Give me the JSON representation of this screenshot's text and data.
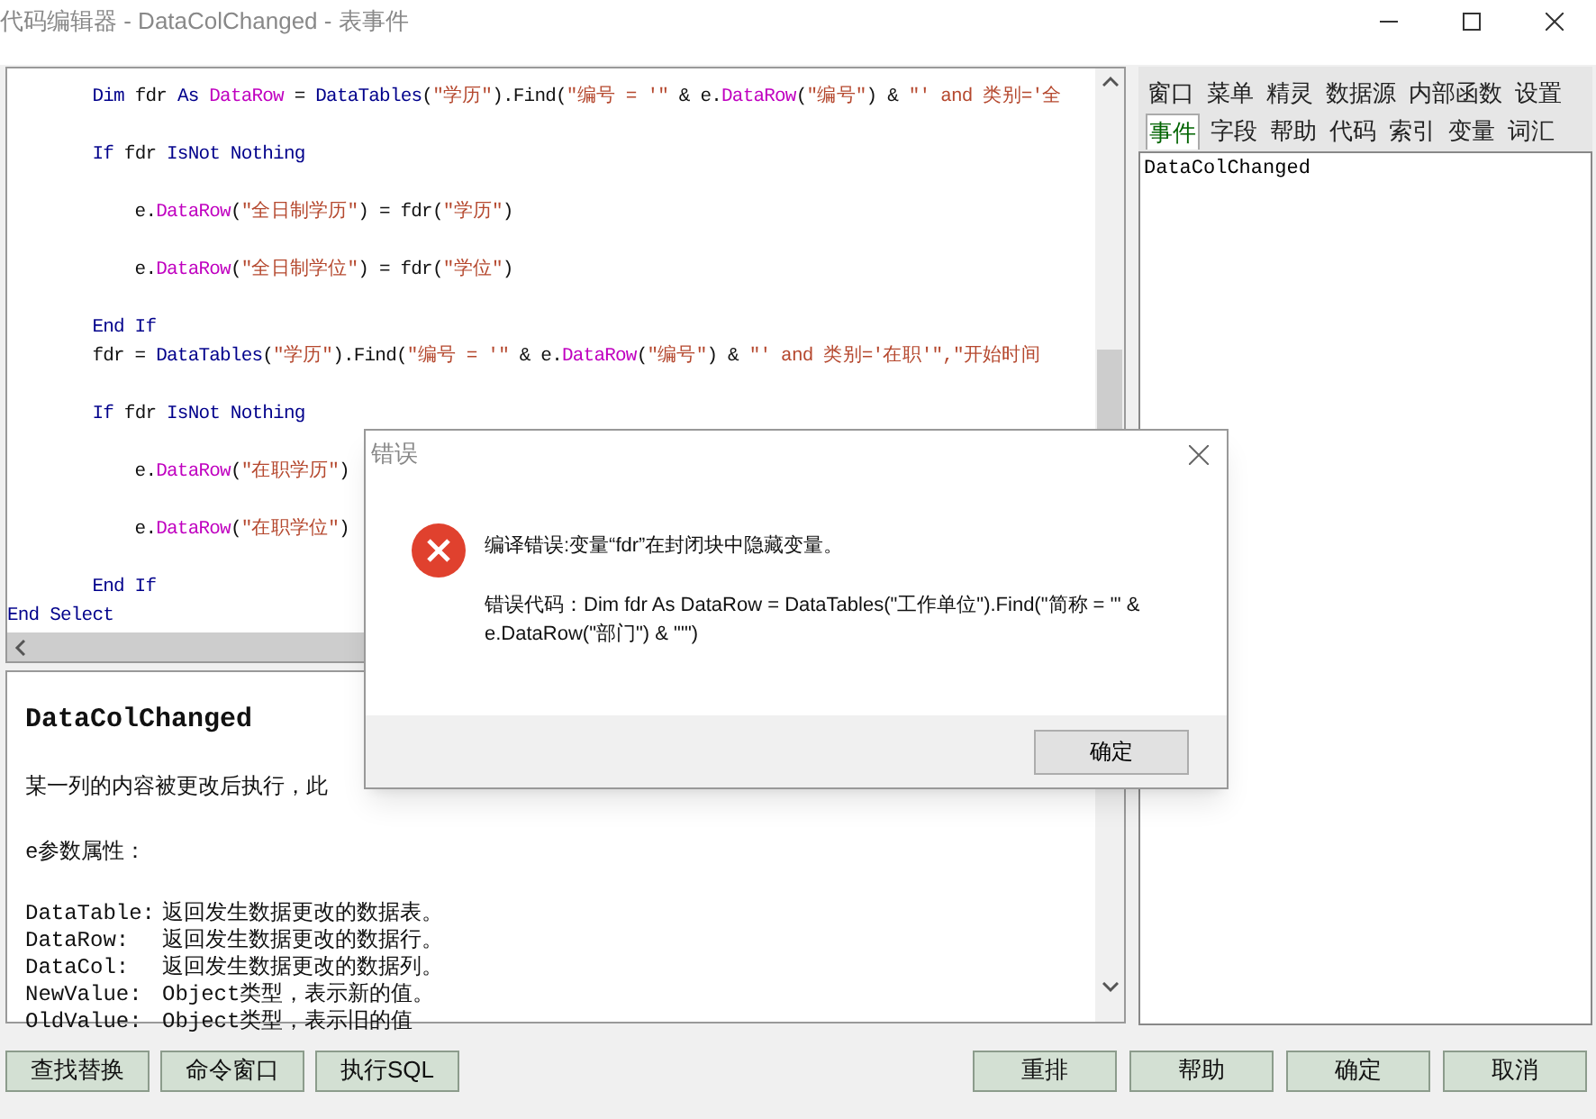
{
  "window": {
    "title": "代码编辑器 - DataColChanged - 表事件"
  },
  "code_blocks": [
    [
      {
        "tokens": [
          {
            "kind": "keyword",
            "text": "        Dim"
          },
          {
            "kind": "plain",
            "text": " fdr "
          },
          {
            "kind": "keyword",
            "text": "As "
          },
          {
            "kind": "member",
            "text": "DataRow"
          },
          {
            "kind": "plain",
            "text": " = "
          },
          {
            "kind": "keyword",
            "text": "DataTables"
          },
          {
            "kind": "plain",
            "text": "("
          },
          {
            "kind": "string",
            "text": "\"学历\""
          },
          {
            "kind": "plain",
            "text": ").Find("
          },
          {
            "kind": "string",
            "text": "\"编号 = '\""
          },
          {
            "kind": "plain",
            "text": " & e."
          },
          {
            "kind": "member",
            "text": "DataRow"
          },
          {
            "kind": "plain",
            "text": "("
          },
          {
            "kind": "string",
            "text": "\"编号\""
          },
          {
            "kind": "plain",
            "text": ") & "
          },
          {
            "kind": "string",
            "text": "\"' and 类别='全"
          }
        ]
      }
    ],
    [
      {
        "tokens": [
          {
            "kind": "keyword",
            "text": "        If"
          },
          {
            "kind": "plain",
            "text": " fdr "
          },
          {
            "kind": "keyword",
            "text": "IsNot Nothing"
          }
        ]
      }
    ],
    [
      {
        "tokens": [
          {
            "kind": "plain",
            "text": "            e."
          },
          {
            "kind": "member",
            "text": "DataRow"
          },
          {
            "kind": "plain",
            "text": "("
          },
          {
            "kind": "string",
            "text": "\"全日制学历\""
          },
          {
            "kind": "plain",
            "text": ") = fdr("
          },
          {
            "kind": "string",
            "text": "\"学历\""
          },
          {
            "kind": "plain",
            "text": ")"
          }
        ]
      }
    ],
    [
      {
        "tokens": [
          {
            "kind": "plain",
            "text": "            e."
          },
          {
            "kind": "member",
            "text": "DataRow"
          },
          {
            "kind": "plain",
            "text": "("
          },
          {
            "kind": "string",
            "text": "\"全日制学位\""
          },
          {
            "kind": "plain",
            "text": ") = fdr("
          },
          {
            "kind": "string",
            "text": "\"学位\""
          },
          {
            "kind": "plain",
            "text": ")"
          }
        ]
      }
    ],
    [
      {
        "tokens": [
          {
            "kind": "keyword",
            "text": "        End If"
          }
        ]
      },
      {
        "tokens": [
          {
            "kind": "plain",
            "text": "        fdr = "
          },
          {
            "kind": "keyword",
            "text": "DataTables"
          },
          {
            "kind": "plain",
            "text": "("
          },
          {
            "kind": "string",
            "text": "\"学历\""
          },
          {
            "kind": "plain",
            "text": ").Find("
          },
          {
            "kind": "string",
            "text": "\"编号 = '\""
          },
          {
            "kind": "plain",
            "text": " & e."
          },
          {
            "kind": "member",
            "text": "DataRow"
          },
          {
            "kind": "plain",
            "text": "("
          },
          {
            "kind": "string",
            "text": "\"编号\""
          },
          {
            "kind": "plain",
            "text": ") & "
          },
          {
            "kind": "string",
            "text": "\"' and 类别='在职'\",\"开始时间"
          }
        ]
      }
    ],
    [
      {
        "tokens": [
          {
            "kind": "keyword",
            "text": "        If"
          },
          {
            "kind": "plain",
            "text": " fdr "
          },
          {
            "kind": "keyword",
            "text": "IsNot Nothing"
          }
        ]
      }
    ],
    [
      {
        "tokens": [
          {
            "kind": "plain",
            "text": "            e."
          },
          {
            "kind": "member",
            "text": "DataRow"
          },
          {
            "kind": "plain",
            "text": "("
          },
          {
            "kind": "string",
            "text": "\"在职学历\""
          },
          {
            "kind": "plain",
            "text": ")"
          }
        ]
      }
    ],
    [
      {
        "tokens": [
          {
            "kind": "plain",
            "text": "            e."
          },
          {
            "kind": "member",
            "text": "DataRow"
          },
          {
            "kind": "plain",
            "text": "("
          },
          {
            "kind": "string",
            "text": "\"在职学位\""
          },
          {
            "kind": "plain",
            "text": ")"
          }
        ]
      }
    ],
    [
      {
        "tokens": [
          {
            "kind": "keyword",
            "text": "        End If"
          }
        ]
      },
      {
        "tokens": [
          {
            "kind": "keyword",
            "text": "End Select"
          }
        ]
      }
    ]
  ],
  "help": {
    "title": "DataColChanged",
    "description": "某一列的内容被更改后执行，此",
    "params_heading": "e参数属性：",
    "params": [
      {
        "name": "DataTable:",
        "desc": "返回发生数据更改的数据表。"
      },
      {
        "name": "DataRow:",
        "desc": "返回发生数据更改的数据行。"
      },
      {
        "name": "DataCol:",
        "desc": "返回发生数据更改的数据列。"
      },
      {
        "name": "NewValue:",
        "desc": "Object类型，表示新的值。"
      },
      {
        "name": "OldValue:",
        "desc": "Object类型，表示旧的值"
      }
    ]
  },
  "side_tabs": [
    [
      {
        "label": "窗口",
        "selected": false
      },
      {
        "label": "菜单",
        "selected": false
      },
      {
        "label": "精灵",
        "selected": false
      },
      {
        "label": "数据源",
        "selected": false
      },
      {
        "label": "内部函数",
        "selected": false
      },
      {
        "label": "设置",
        "selected": false
      }
    ],
    [
      {
        "label": "事件",
        "selected": true
      },
      {
        "label": "字段",
        "selected": false
      },
      {
        "label": "帮助",
        "selected": false
      },
      {
        "label": "代码",
        "selected": false
      },
      {
        "label": "索引",
        "selected": false
      },
      {
        "label": "变量",
        "selected": false
      },
      {
        "label": "词汇",
        "selected": false
      }
    ]
  ],
  "side_list": [
    "DataColChanged"
  ],
  "left_buttons": [
    "查找替换",
    "命令窗口",
    "执行SQL"
  ],
  "right_buttons": [
    "重排",
    "帮助",
    "确定",
    "取消"
  ],
  "dialog": {
    "title": "错误",
    "message": "编译错误:变量“fdr”在封闭块中隐藏变量。",
    "detail": "错误代码：Dim fdr As DataRow = DataTables(\"工作单位\").Find(\"简称 = '\" & e.DataRow(\"部门\") & \"'\")",
    "button": "确定"
  }
}
